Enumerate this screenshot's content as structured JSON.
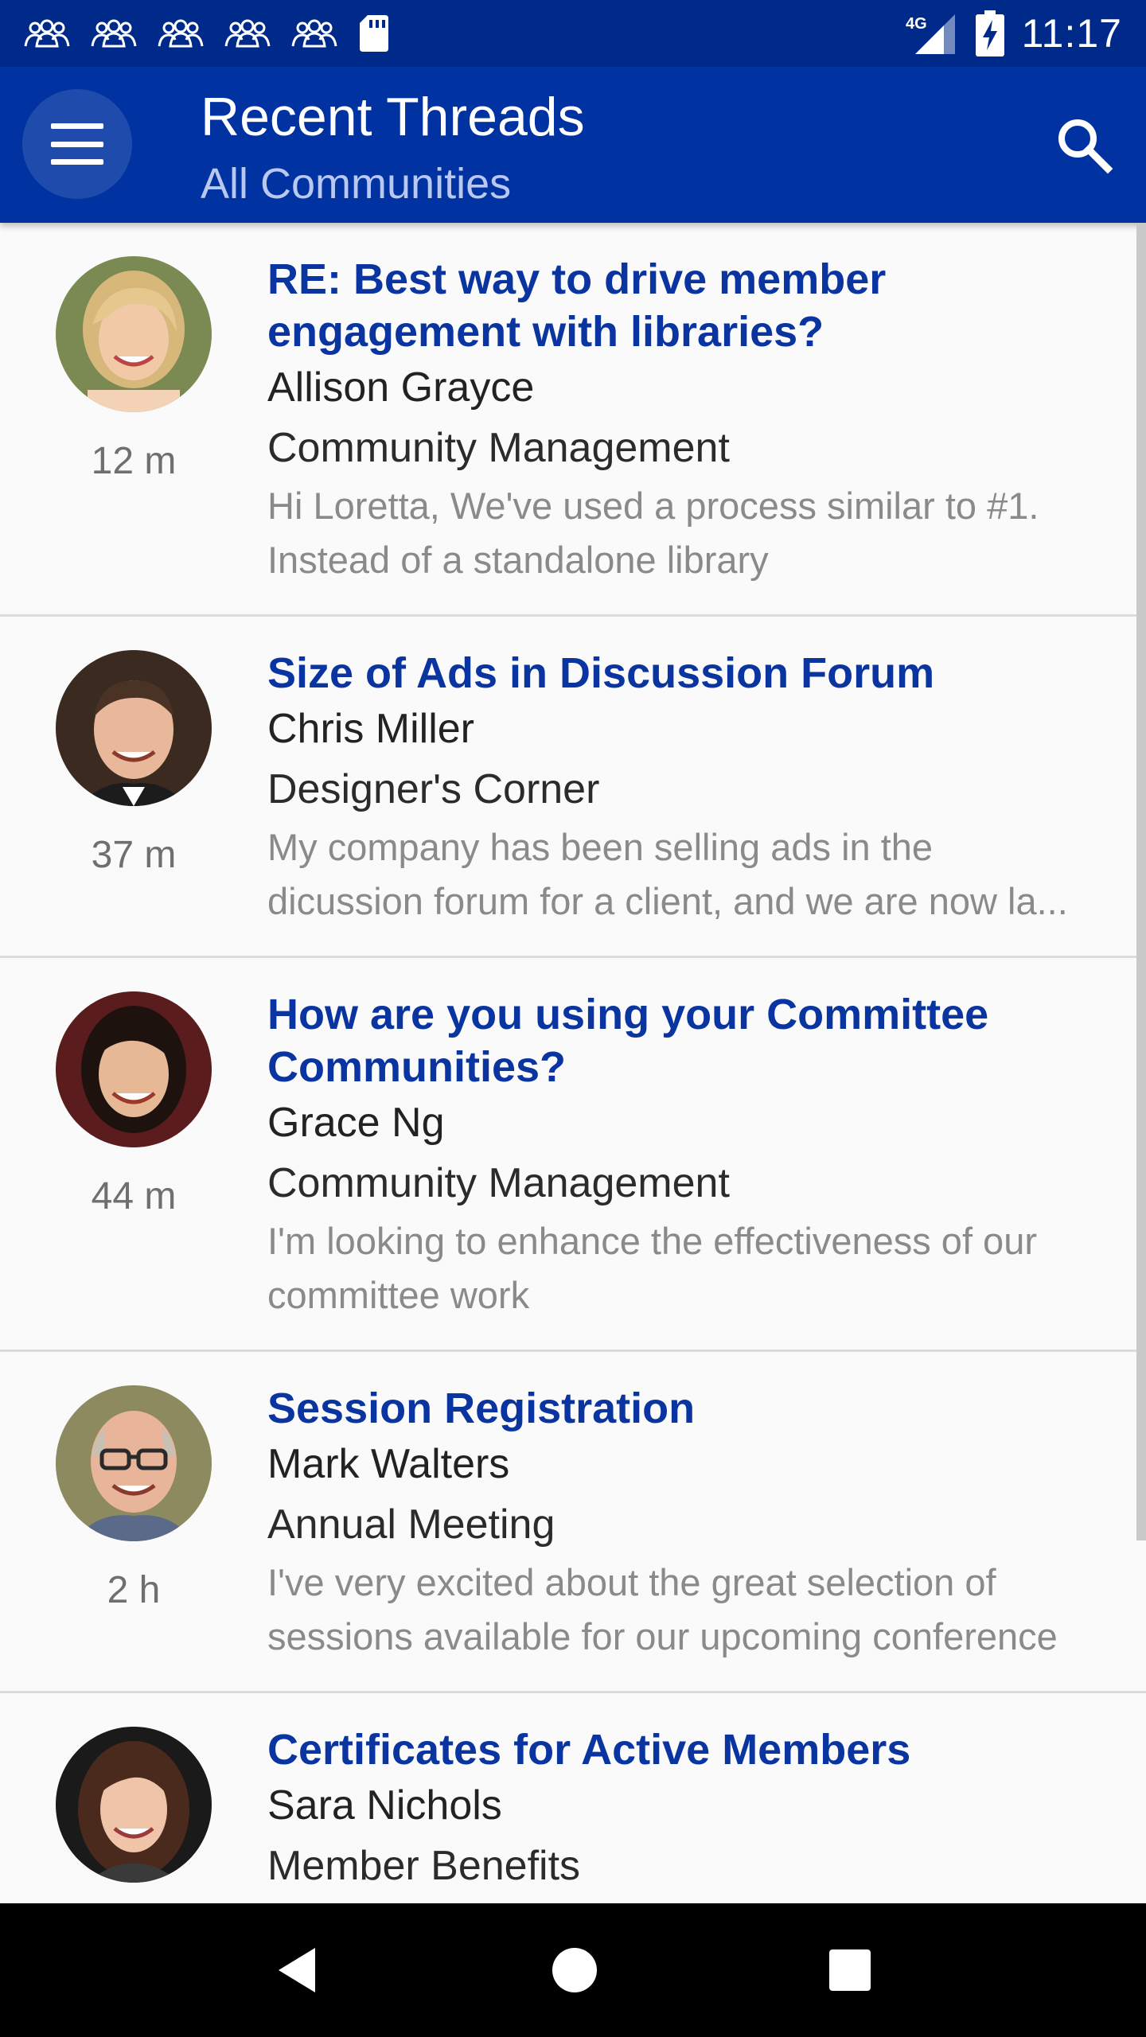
{
  "status_bar": {
    "time": "11:17",
    "network": "4G",
    "notification_icons": [
      "community-icon",
      "community-icon",
      "community-icon",
      "community-icon",
      "community-icon",
      "sd-card-icon"
    ],
    "right_icons": [
      "signal-4g-icon",
      "battery-charging-icon"
    ]
  },
  "header": {
    "title": "Recent Threads",
    "subtitle": "All Communities",
    "menu_icon": "hamburger-menu-icon",
    "search_icon": "search-icon",
    "background_color": "#0033a1"
  },
  "threads": [
    {
      "title": "RE: Best way to drive member engagement with libraries?",
      "author": "Allison Grayce",
      "community": "Community Management",
      "preview": "Hi Loretta, We've used a process similar to #1. Instead of a standalone library",
      "time": "12 m"
    },
    {
      "title": "Size of Ads in Discussion Forum",
      "author": "Chris Miller",
      "community": "Designer's Corner",
      "preview": "My company has been selling ads in the dicussion forum for a client, and we are now la...",
      "time": "37 m"
    },
    {
      "title": "How are you using your Committee Communities?",
      "author": "Grace Ng",
      "community": "Community Management",
      "preview": "I'm looking to enhance the effectiveness of our committee work",
      "time": "44 m"
    },
    {
      "title": "Session Registration",
      "author": "Mark Walters",
      "community": "Annual Meeting",
      "preview": "I've very excited about the great selection of sessions available for our upcoming conference",
      "time": "2 h"
    },
    {
      "title": "Certificates for Active Members",
      "author": "Sara Nichols",
      "community": "Member Benefits",
      "preview": "",
      "time": ""
    }
  ],
  "nav_bar": {
    "icons": [
      "back-icon",
      "home-icon",
      "recents-icon"
    ]
  }
}
